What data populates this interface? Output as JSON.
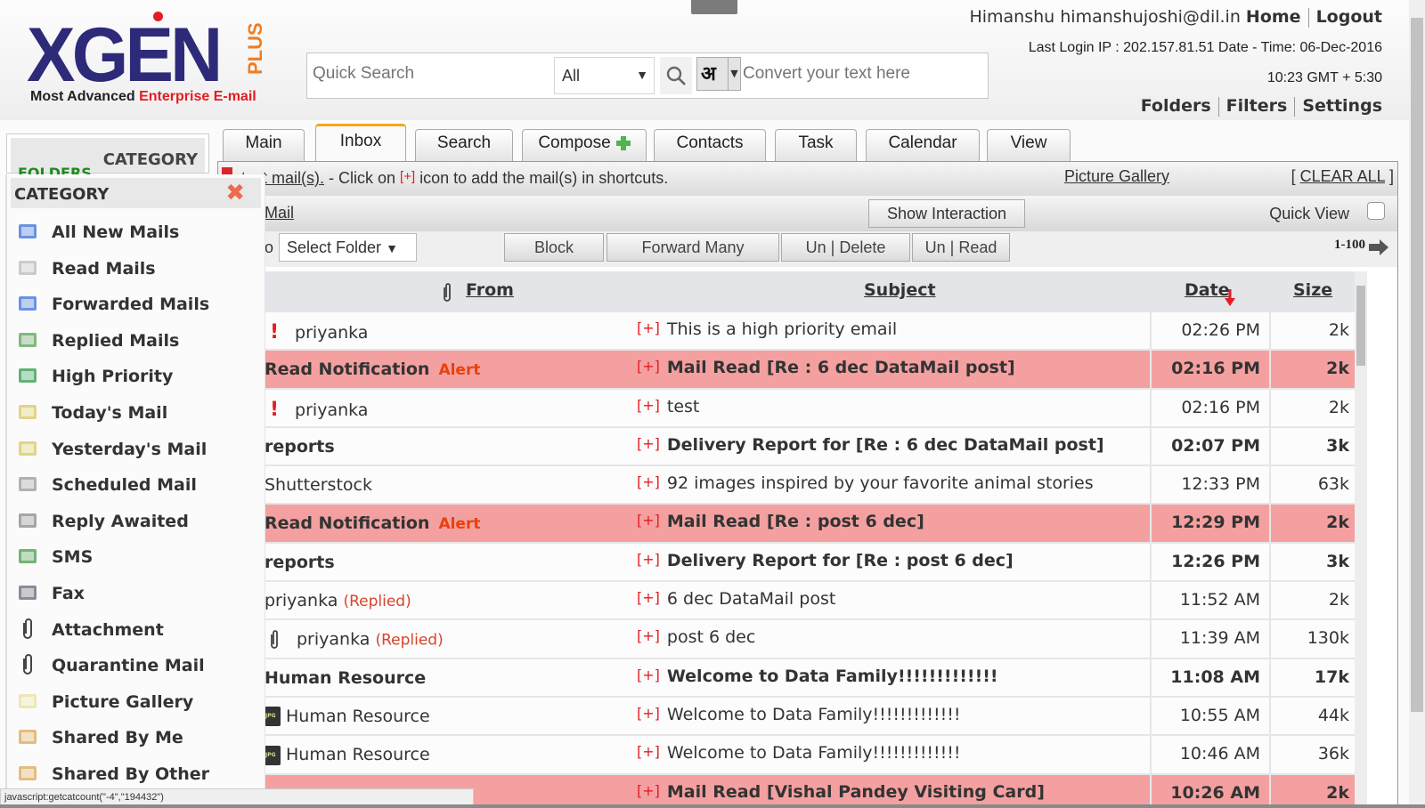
{
  "app": {
    "logo_main": "XGEN",
    "logo_plus": "PLUS",
    "logo_tag_dark": "Most Advanced",
    "logo_tag_red": "Enterprise E-mail"
  },
  "search": {
    "placeholder": "Quick Search",
    "scope_selected": "All",
    "hindi_glyph": "अ",
    "convert_placeholder": "Convert your text here"
  },
  "user": {
    "name": "Himanshu",
    "email": "himanshujoshi@dil.in",
    "home_label": "Home",
    "logout_label": "Logout",
    "last_login": "Last Login IP : 202.157.81.51 Date - Time: 06-Dec-2016",
    "login_time": "10:23 GMT + 5:30"
  },
  "toplinks": [
    "Folders",
    "Filters",
    "Settings"
  ],
  "folder_panel": {
    "category_label": "CATEGORY",
    "folders_label": "FOLDERS"
  },
  "tabs": [
    {
      "label": "Main",
      "active": false
    },
    {
      "label": "Inbox",
      "active": true
    },
    {
      "label": "Search",
      "active": false
    },
    {
      "label": "Compose",
      "active": false
    },
    {
      "label": "Contacts",
      "active": false
    },
    {
      "label": "Task",
      "active": false
    },
    {
      "label": "Calendar",
      "active": false
    },
    {
      "label": "View",
      "active": false
    }
  ],
  "shortcut_bar": {
    "link": "rtcut mail(s).",
    "text1": " - Click on ",
    "plus": "[+]",
    "text2": " icon to add the mail(s) in shortcuts.",
    "picture_gallery": "Picture Gallery",
    "clear_all": "CLEAR ALL"
  },
  "toolbar": {
    "mail_link": "Mail",
    "show_interaction": "Show Interaction",
    "quick_view": "Quick View",
    "move_to": "o",
    "select_folder": "Select Folder",
    "block": "Block",
    "forward_many": "Forward Many",
    "undelete": "Un | Delete",
    "unread": "Un | Read",
    "pagination": "1-100"
  },
  "table": {
    "headers": {
      "from": "From",
      "subject": "Subject",
      "date": "Date",
      "size": "Size"
    },
    "rows": [
      {
        "from": "priyanka",
        "subject": "This is a high priority email",
        "date": "02:26 PM",
        "size": "2k",
        "bold": false,
        "alert": false,
        "priority": true
      },
      {
        "from": "Read Notification",
        "tag": "Alert",
        "subject": "Mail Read [Re : 6 dec DataMail post]",
        "date": "02:16 PM",
        "size": "2k",
        "bold": true,
        "alert": true
      },
      {
        "from": "priyanka",
        "subject": "test",
        "date": "02:16 PM",
        "size": "2k",
        "bold": false,
        "alert": false,
        "priority": true
      },
      {
        "from": "reports",
        "subject": "Delivery Report for [Re : 6 dec DataMail post]",
        "date": "02:07 PM",
        "size": "3k",
        "bold": true,
        "alert": false
      },
      {
        "from": "Shutterstock",
        "subject": "92 images inspired by your favorite animal stories",
        "date": "12:33 PM",
        "size": "63k",
        "bold": false,
        "alert": false
      },
      {
        "from": "Read Notification",
        "tag": "Alert",
        "subject": "Mail Read [Re : post 6 dec]",
        "date": "12:29 PM",
        "size": "2k",
        "bold": true,
        "alert": true
      },
      {
        "from": "reports",
        "subject": "Delivery Report for [Re : post 6 dec]",
        "date": "12:26 PM",
        "size": "3k",
        "bold": true,
        "alert": false
      },
      {
        "from": "priyanka",
        "status": "(Replied)",
        "subject": "6 dec DataMail post",
        "date": "11:52 AM",
        "size": "2k",
        "bold": false,
        "alert": false
      },
      {
        "from": "priyanka",
        "status": "(Replied)",
        "subject": "post 6 dec",
        "date": "11:39 AM",
        "size": "130k",
        "bold": false,
        "alert": false,
        "attachment": true
      },
      {
        "from": "Human Resource",
        "subject": "Welcome to Data Family!!!!!!!!!!!!!",
        "date": "11:08 AM",
        "size": "17k",
        "bold": true,
        "alert": false
      },
      {
        "from": "Human Resource",
        "subject": "Welcome to Data Family!!!!!!!!!!!!!",
        "date": "10:55 AM",
        "size": "44k",
        "bold": false,
        "alert": false,
        "jpg": true
      },
      {
        "from": "Human Resource",
        "subject": "Welcome to Data Family!!!!!!!!!!!!!",
        "date": "10:46 AM",
        "size": "36k",
        "bold": false,
        "alert": false,
        "jpg": true
      },
      {
        "from": "",
        "subject": "Mail Read [Vishal Pandey Visiting Card]",
        "date": "10:26 AM",
        "size": "2k",
        "bold": true,
        "alert": true
      }
    ]
  },
  "category_popup": {
    "title": "CATEGORY",
    "items": [
      {
        "label": "All New Mails",
        "icon": "all-new-mails-icon"
      },
      {
        "label": "Read Mails",
        "icon": "read-mails-icon"
      },
      {
        "label": "Forwarded Mails",
        "icon": "forwarded-mails-icon"
      },
      {
        "label": "Replied Mails",
        "icon": "replied-mails-icon"
      },
      {
        "label": "High Priority",
        "icon": "high-priority-icon"
      },
      {
        "label": "Today's Mail",
        "icon": "todays-mail-icon"
      },
      {
        "label": "Yesterday's Mail",
        "icon": "yesterdays-mail-icon"
      },
      {
        "label": "Scheduled Mail",
        "icon": "scheduled-mail-icon"
      },
      {
        "label": "Reply Awaited",
        "icon": "reply-awaited-icon"
      },
      {
        "label": "SMS",
        "icon": "sms-icon"
      },
      {
        "label": "Fax",
        "icon": "fax-icon"
      },
      {
        "label": "Attachment",
        "icon": "paperclip-icon"
      },
      {
        "label": "Quarantine Mail",
        "icon": "paperclip-icon"
      },
      {
        "label": "Picture Gallery",
        "icon": "picture-gallery-icon"
      },
      {
        "label": "Shared By Me",
        "icon": "shared-by-me-icon"
      },
      {
        "label": "Shared By Other",
        "icon": "shared-by-other-icon"
      }
    ]
  },
  "statusbar": {
    "text": "javascript:getcatcount(\"-4\",\"194432\")"
  },
  "colors": {
    "alert_row": "#f4a0a0",
    "brand_navy": "#2e2a7a",
    "brand_red": "#e41c23",
    "brand_orange": "#ef7d22",
    "active_tab_top": "#f0a81e"
  }
}
